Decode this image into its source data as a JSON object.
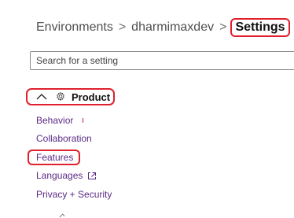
{
  "breadcrumb": {
    "items": [
      "Environments",
      "dharmimaxdev"
    ],
    "separator": ">",
    "current": "Settings"
  },
  "search": {
    "placeholder": "Search for a setting",
    "value": ""
  },
  "section": {
    "title": "Product",
    "icon": "gear-icon",
    "expanded": true
  },
  "nav": {
    "items": [
      {
        "label": "Behavior"
      },
      {
        "label": "Collaboration"
      },
      {
        "label": "Features"
      },
      {
        "label": "Languages"
      },
      {
        "label": "Privacy + Security"
      }
    ]
  },
  "colors": {
    "link": "#5b2a86",
    "highlight": "#e0202c",
    "text": "#111111"
  }
}
